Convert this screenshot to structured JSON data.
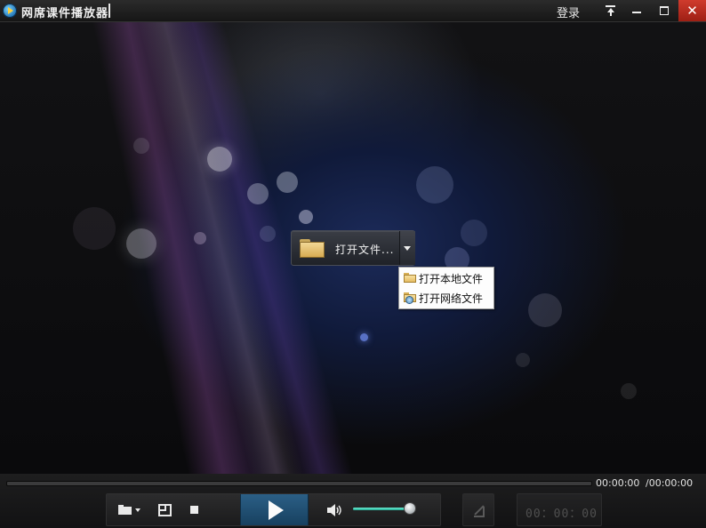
{
  "titlebar": {
    "app_title": "网席课件播放器",
    "login_label": "登录"
  },
  "center": {
    "open_button_label": "打开文件..."
  },
  "dropdown": {
    "items": [
      {
        "label": "打开本地文件",
        "icon": "folder-icon"
      },
      {
        "label": "打开网络文件",
        "icon": "network-folder-icon"
      }
    ]
  },
  "playback": {
    "current_time": "00:00:00",
    "total_time": "/00:00:00",
    "progress": 0,
    "volume_percent": 92,
    "clock_display": "00：00：00"
  },
  "colors": {
    "close_button": "#c0392b",
    "play_button": "#245478",
    "volume_fill": "#3ad6b8"
  }
}
